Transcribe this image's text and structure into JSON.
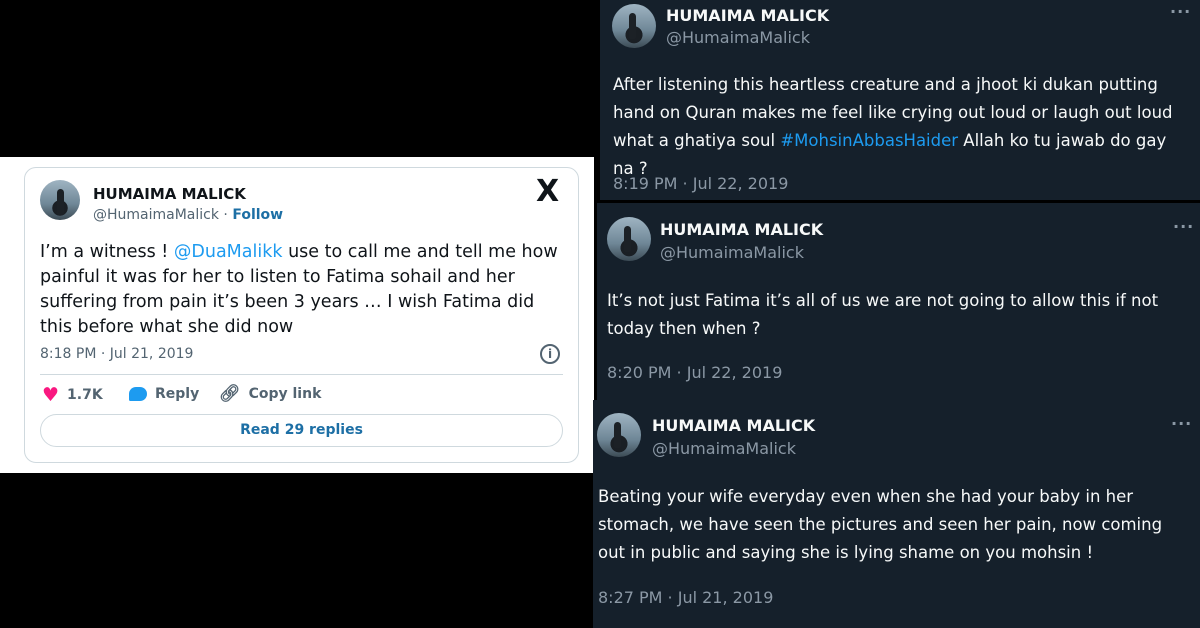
{
  "light_tweet": {
    "name": "HUMAIMA MALICK",
    "handle": "@HumaimaMalick",
    "separator": "·",
    "follow": "Follow",
    "text_before": "I’m a witness ! ",
    "mention": "@DuaMalikk",
    "text_after": " use to call me and tell me how painful it was for her to listen to Fatima sohail and her suffering from pain it’s been 3 years … I wish Fatima did this before what she did now",
    "time": "8:18 PM · Jul 21, 2019",
    "likes": "1.7K",
    "reply": "Reply",
    "copy_link": "Copy link",
    "read_replies": "Read 29 replies",
    "logo": "X"
  },
  "dark_tweets": [
    {
      "name": "HUMAIMA MALICK",
      "handle": "@HumaimaMalick",
      "text_before": "After listening this heartless creature and a jhoot ki dukan putting hand on Quran makes me feel like crying out loud or laugh out loud what a ghatiya soul ",
      "hashtag": "#MohsinAbbasHaider",
      "text_after": " Allah ko tu jawab do gay na ?",
      "time": "8:19 PM · Jul 22, 2019",
      "more": "···"
    },
    {
      "name": "HUMAIMA MALICK",
      "handle": "@HumaimaMalick",
      "text": "It’s not just Fatima it’s all of us we are not going to allow this if not today then when ?",
      "time": "8:20 PM · Jul 22, 2019",
      "more": "···"
    },
    {
      "name": "HUMAIMA MALICK",
      "handle": "@HumaimaMalick",
      "text": "Beating your wife everyday even when she had your baby in her stomach, we have seen the pictures and seen her pain,  now coming out in public and saying she is lying shame on you mohsin !",
      "time": "8:27 PM · Jul 21, 2019",
      "more": "···"
    }
  ],
  "colors": {
    "dark_bg": "#15202b",
    "link_blue": "#1d9bf0",
    "like_pink": "#f91880",
    "muted_gray": "#536471"
  },
  "icons": [
    "x-logo-icon",
    "info-icon",
    "heart-icon",
    "reply-bubble-icon",
    "copy-link-icon",
    "more-options-icon",
    "avatar"
  ]
}
